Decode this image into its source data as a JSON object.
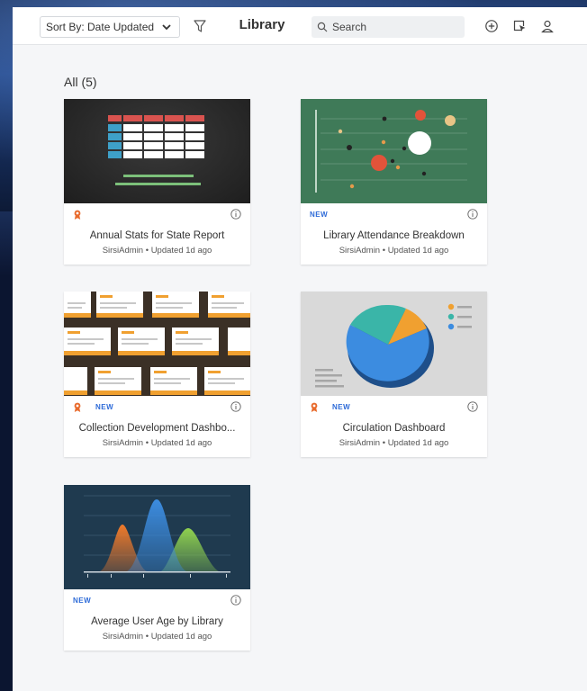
{
  "toolbar": {
    "sort_label": "Sort By: Date Updated",
    "title": "Library",
    "search_placeholder": "Search",
    "icons": [
      "chevron-down-icon",
      "filter-icon",
      "search-icon",
      "add-circle-icon",
      "select-pointer-icon",
      "user-icon"
    ]
  },
  "section": {
    "title": "All (5)"
  },
  "cards": [
    {
      "title": "Annual Stats for State Report",
      "subtitle": "SirsiAdmin • Updated 1d ago",
      "badge": "",
      "certified": true,
      "thumbnail": "table-chart"
    },
    {
      "title": "Library Attendance Breakdown",
      "subtitle": "SirsiAdmin • Updated 1d ago",
      "badge": "NEW",
      "certified": false,
      "thumbnail": "scatter-chart"
    },
    {
      "title": "Collection Development Dashbo...",
      "subtitle": "SirsiAdmin • Updated 1d ago",
      "badge": "NEW",
      "certified": true,
      "thumbnail": "dashboard-grid"
    },
    {
      "title": "Circulation Dashboard",
      "subtitle": "SirsiAdmin • Updated 1d ago",
      "badge": "NEW",
      "certified": true,
      "thumbnail": "pie-chart"
    },
    {
      "title": "Average User Age by Library",
      "subtitle": "SirsiAdmin • Updated 1d ago",
      "badge": "NEW",
      "certified": false,
      "thumbnail": "area-chart"
    }
  ],
  "colors": {
    "accent_blue": "#2e6bd8",
    "certified_orange": "#e86a2c",
    "green_thumb": "#3f7a58",
    "navy_thumb": "#1f3a4f"
  }
}
